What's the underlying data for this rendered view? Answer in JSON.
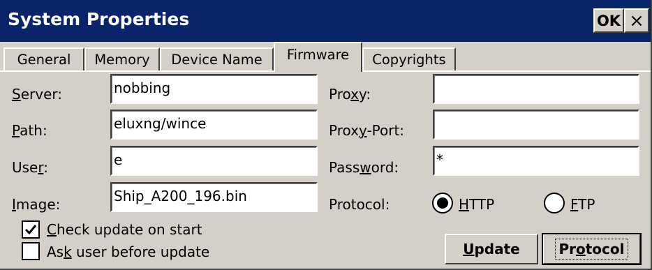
{
  "window": {
    "title": "System Properties",
    "ok_label": "OK",
    "close_label": "×"
  },
  "tabs": [
    {
      "label": "General",
      "active": false
    },
    {
      "label": "Memory",
      "active": false
    },
    {
      "label": "Device Name",
      "active": false
    },
    {
      "label": "Firmware",
      "active": true
    },
    {
      "label": "Copyrights",
      "active": false
    }
  ],
  "firmware": {
    "server": {
      "pre": "",
      "key": "S",
      "post": "erver:",
      "value": "nobbing"
    },
    "path": {
      "pre": "",
      "key": "P",
      "post": "ath:",
      "value": "eluxng/wince"
    },
    "user": {
      "pre": "Use",
      "key": "r",
      "post": ":",
      "value": "e"
    },
    "image": {
      "pre": "",
      "key": "I",
      "post": "mage:",
      "value": "Ship_A200_196.bin"
    },
    "proxy": {
      "pre": "Pro",
      "key": "x",
      "post": "y:",
      "value": ""
    },
    "proxy_port": {
      "pre": "Prox",
      "key": "y",
      "post": "-Port:",
      "value": ""
    },
    "password": {
      "pre": "Pass",
      "key": "w",
      "post": "ord:",
      "value": "*"
    },
    "protocol": {
      "label": "Protocol:",
      "options": [
        {
          "key": "H",
          "rest": "TTP",
          "selected": true
        },
        {
          "key": "F",
          "rest": "TP",
          "selected": false
        }
      ]
    },
    "check_update": {
      "key": "C",
      "rest": "heck update on start",
      "checked": true
    },
    "ask_user": {
      "pre": "As",
      "key": "k",
      "post": " user before update",
      "checked": false
    },
    "update_button": {
      "key": "U",
      "rest": "pdate"
    },
    "protocol_button": {
      "pre": "Pr",
      "key": "o",
      "post": "tocol"
    }
  }
}
